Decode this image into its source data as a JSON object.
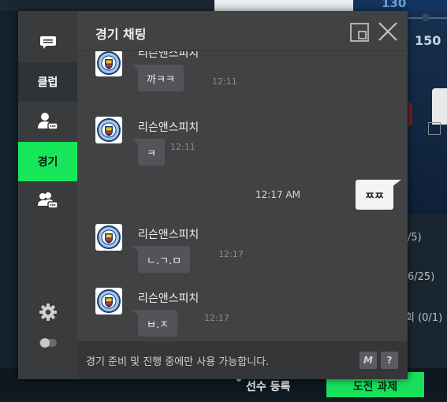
{
  "background": {
    "score_top": "130",
    "score": "150",
    "stats": [
      "/5)",
      "6/25)",
      "회 (0/1)"
    ],
    "player_register": "선수 등록",
    "challenge_button": "도전 과제"
  },
  "chat": {
    "title": "경기 채팅",
    "sidebar": {
      "items": [
        {
          "name": "chat",
          "icon": "chat-bubble-icon"
        },
        {
          "name": "club",
          "label": "클럽"
        },
        {
          "name": "friend",
          "icon": "user-chat-icon"
        },
        {
          "name": "match",
          "label": "경기",
          "active_color": "#18e65a"
        },
        {
          "name": "group",
          "icon": "group-chat-icon"
        },
        {
          "name": "settings",
          "icon": "gear-icon"
        },
        {
          "name": "toggle",
          "icon": "toggle-icon"
        }
      ]
    },
    "messages": [
      {
        "sender": "리슨앤스피치",
        "text": "까ㅋㅋ",
        "time": "12:11",
        "mine": false
      },
      {
        "sender": "리슨앤스피치",
        "text": "ㅋ",
        "time": "12:11",
        "mine": false
      },
      {
        "sender": "",
        "text": "ㅉㅉ",
        "time": "12:17 AM",
        "mine": true
      },
      {
        "sender": "리슨앤스피치",
        "text": "ㄴ.ㄱ.ㅁ",
        "time": "12:17",
        "mine": false
      },
      {
        "sender": "리슨앤스피치",
        "text": "ㅂ.ㅈ",
        "time": "12:17",
        "mine": false
      }
    ],
    "footer": {
      "notice": "경기 준비 및 진행 중에만 사용 가능합니다.",
      "macro_button": "M",
      "help_button": "?"
    }
  }
}
